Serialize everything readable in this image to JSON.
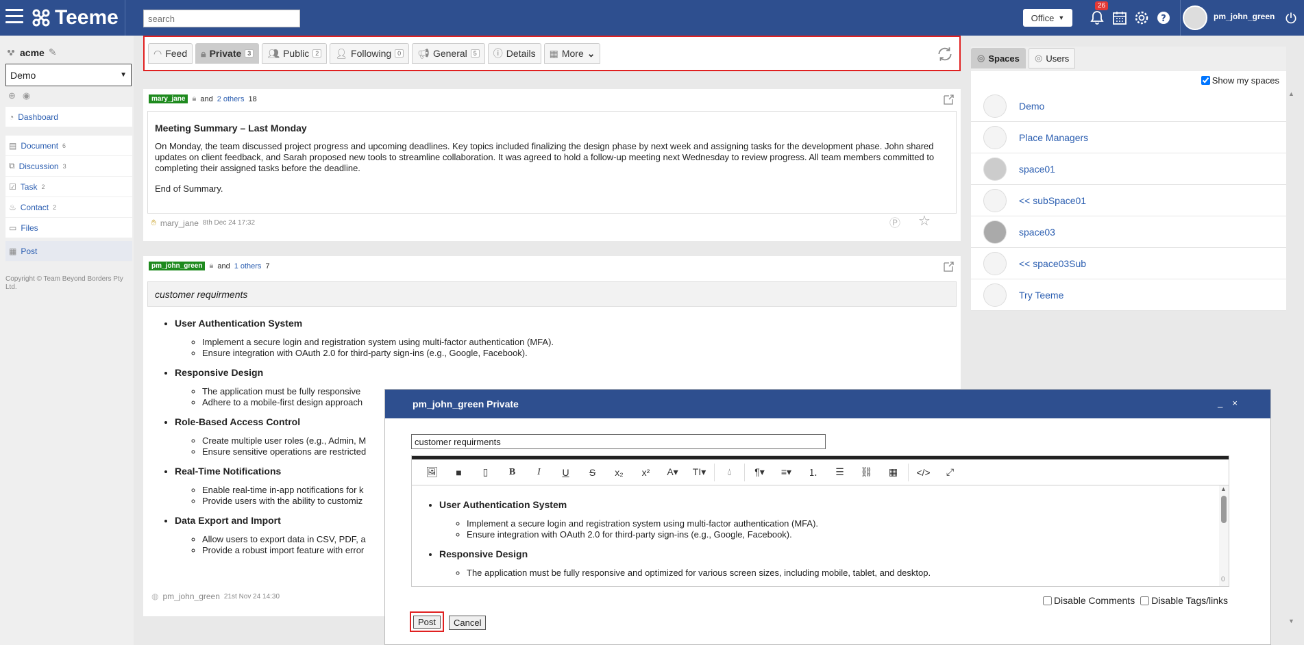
{
  "topbar": {
    "brand": "Teeme",
    "search_placeholder": "search",
    "office_label": "Office",
    "notif_count": "26",
    "username": "pm_john_green"
  },
  "sidebar": {
    "org": "acme",
    "space_selected": "Demo",
    "items": [
      {
        "label": "Dashboard",
        "count": ""
      },
      {
        "label": "Document",
        "count": "6"
      },
      {
        "label": "Discussion",
        "count": "3"
      },
      {
        "label": "Task",
        "count": "2"
      },
      {
        "label": "Contact",
        "count": "2"
      },
      {
        "label": "Files",
        "count": ""
      },
      {
        "label": "Post",
        "count": ""
      }
    ],
    "copyright": "Copyright © Team Beyond Borders Pty Ltd."
  },
  "tabs": [
    {
      "label": "Feed",
      "count": ""
    },
    {
      "label": "Private",
      "count": "3"
    },
    {
      "label": "Public",
      "count": "2"
    },
    {
      "label": "Following",
      "count": "0"
    },
    {
      "label": "General",
      "count": "5"
    },
    {
      "label": "Details",
      "count": ""
    },
    {
      "label": "More",
      "count": ""
    }
  ],
  "post1": {
    "user": "mary_jane",
    "and_text": "and",
    "others": "2 others",
    "count": "18",
    "title": "Meeting Summary – Last Monday",
    "para1": "On Monday, the team discussed project progress and upcoming deadlines. Key topics included finalizing the design phase by next week and assigning tasks for the development phase. John shared updates on client feedback, and Sarah proposed new tools to streamline collaboration. It was agreed to hold a follow-up meeting next Wednesday to review progress. All team members committed to completing their assigned tasks before the deadline.",
    "para2": "End of Summary.",
    "author": "mary_jane",
    "date": "8th Dec 24 17:32"
  },
  "post2": {
    "user": "pm_john_green",
    "and_text": "and",
    "others": "1 others",
    "count": "7",
    "subject": "customer requirments",
    "sections": [
      {
        "title": "User Authentication System",
        "items": [
          "Implement a secure login and registration system using multi-factor authentication (MFA).",
          "Ensure integration with OAuth 2.0 for third-party sign-ins (e.g., Google, Facebook)."
        ]
      },
      {
        "title": "Responsive Design",
        "items": [
          "The application must be fully responsive",
          "Adhere to a mobile-first design approach"
        ]
      },
      {
        "title": "Role-Based Access Control",
        "items": [
          "Create multiple user roles (e.g., Admin, M",
          "Ensure sensitive operations are restricted"
        ]
      },
      {
        "title": "Real-Time Notifications",
        "items": [
          "Enable real-time in-app notifications for k",
          "Provide users with the ability to customiz"
        ]
      },
      {
        "title": "Data Export and Import",
        "items": [
          "Allow users to export data in CSV, PDF, a",
          "Provide a robust import feature with error"
        ]
      }
    ],
    "author": "pm_john_green",
    "date": "21st Nov 24 14:30"
  },
  "rpanel": {
    "tab_spaces": "Spaces",
    "tab_users": "Users",
    "show_my": "Show my spaces",
    "spaces": [
      "Demo",
      "Place Managers",
      "space01",
      "<< subSpace01",
      "space03",
      "<< space03Sub",
      "Try Teeme"
    ]
  },
  "modal": {
    "title": "pm_john_green Private",
    "minimize": "_",
    "close": "×",
    "subject_value": "customer requirments",
    "editor_sections": [
      {
        "title": "User Authentication System",
        "items": [
          "Implement a secure login and registration system using multi-factor authentication (MFA).",
          "Ensure integration with OAuth 2.0 for third-party sign-ins (e.g., Google, Facebook)."
        ]
      },
      {
        "title": "Responsive Design",
        "items": [
          "The application must be fully responsive and optimized for various screen sizes, including mobile, tablet, and desktop."
        ]
      }
    ],
    "scroll_count": "0",
    "disable_comments": "Disable Comments",
    "disable_tags": "Disable Tags/links",
    "post_label": "Post",
    "cancel_label": "Cancel"
  },
  "colors": {
    "topbar": "#2e4f8f",
    "user_label": "#1e8a1e",
    "highlight": "#e02020",
    "link": "#2a5db0"
  }
}
